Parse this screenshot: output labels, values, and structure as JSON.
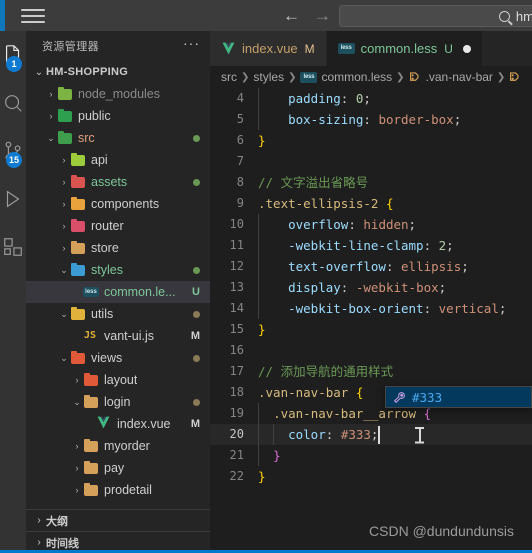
{
  "titlebar": {
    "menu_icon": "hamburger-menu-icon",
    "back_arrow": "←",
    "forward_arrow": "→",
    "search_value": "hm-sh",
    "search_icon": "search-icon"
  },
  "activitybar": {
    "items": [
      {
        "name": "explorer",
        "icon": "files-icon",
        "badge": "1"
      },
      {
        "name": "search",
        "icon": "search-icon",
        "badge": ""
      },
      {
        "name": "source-control",
        "icon": "source-control-icon",
        "badge": "15"
      },
      {
        "name": "run-and-debug",
        "icon": "run-debug-icon",
        "badge": ""
      },
      {
        "name": "extensions",
        "icon": "extensions-icon",
        "badge": ""
      }
    ]
  },
  "sidebar": {
    "title": "资源管理器",
    "more_actions": "···",
    "root": {
      "label": "HM-SHOPPING",
      "chevron": "⌄"
    },
    "tree": [
      {
        "indent": 1,
        "chevron": "›",
        "icon": "folder-node-modules",
        "color": "#7cb342",
        "label": "node_modules",
        "text_color": "#8a8a8a",
        "status": "",
        "dot": ""
      },
      {
        "indent": 1,
        "chevron": "›",
        "icon": "folder-public",
        "color": "#2e9e4f",
        "label": "public",
        "text_color": "#cfcfcf",
        "status": "",
        "dot": ""
      },
      {
        "indent": 1,
        "chevron": "⌄",
        "icon": "folder-src",
        "color": "#3f9e4d",
        "label": "src",
        "text_color": "#e0a080",
        "status": "",
        "dot": "#6a9955"
      },
      {
        "indent": 2,
        "chevron": "›",
        "icon": "folder-api",
        "color": "#9ccc3c",
        "label": "api",
        "text_color": "#cfcfcf",
        "status": "",
        "dot": ""
      },
      {
        "indent": 2,
        "chevron": "›",
        "icon": "folder-assets",
        "color": "#d9544f",
        "label": "assets",
        "text_color": "#7ec699",
        "status": "",
        "dot": "#6a9955"
      },
      {
        "indent": 2,
        "chevron": "›",
        "icon": "folder-components",
        "color": "#e8a33d",
        "label": "components",
        "text_color": "#cfcfcf",
        "status": "",
        "dot": ""
      },
      {
        "indent": 2,
        "chevron": "›",
        "icon": "folder-router",
        "color": "#d94f6a",
        "label": "router",
        "text_color": "#cfcfcf",
        "status": "",
        "dot": ""
      },
      {
        "indent": 2,
        "chevron": "›",
        "icon": "folder-store",
        "color": "#d5a05a",
        "label": "store",
        "text_color": "#cfcfcf",
        "status": "",
        "dot": ""
      },
      {
        "indent": 2,
        "chevron": "⌄",
        "icon": "folder-styles",
        "color": "#3d9bd4",
        "label": "styles",
        "text_color": "#7ec699",
        "status": "",
        "dot": "#6a9955"
      },
      {
        "indent": 3,
        "chevron": "",
        "icon": "file-less",
        "color": "#1e4f5f",
        "label": "common.le...",
        "text_color": "#7ec699",
        "status": "U",
        "status_color": "#7ec699",
        "dot": "",
        "selected": true
      },
      {
        "indent": 2,
        "chevron": "⌄",
        "icon": "folder-utils",
        "color": "#e0b23c",
        "label": "utils",
        "text_color": "#cfcfcf",
        "status": "",
        "dot": "#8a7a55"
      },
      {
        "indent": 3,
        "chevron": "",
        "icon": "file-js",
        "color": "#e0b23c",
        "label": "vant-ui.js",
        "text_color": "#cfcfcf",
        "status": "M",
        "status_color": "#cfcfcf",
        "dot": ""
      },
      {
        "indent": 2,
        "chevron": "⌄",
        "icon": "folder-views",
        "color": "#e05a3a",
        "label": "views",
        "text_color": "#cfcfcf",
        "status": "",
        "dot": "#8a7a55"
      },
      {
        "indent": 3,
        "chevron": "›",
        "icon": "folder-layout",
        "color": "#e05a3a",
        "label": "layout",
        "text_color": "#cfcfcf",
        "status": "",
        "dot": ""
      },
      {
        "indent": 3,
        "chevron": "⌄",
        "icon": "folder-login",
        "color": "#d5a05a",
        "label": "login",
        "text_color": "#cfcfcf",
        "status": "",
        "dot": "#8a7a55"
      },
      {
        "indent": 4,
        "chevron": "",
        "icon": "file-vue",
        "color": "#41b883",
        "label": "index.vue",
        "text_color": "#cfcfcf",
        "status": "M",
        "status_color": "#cfcfcf",
        "dot": ""
      },
      {
        "indent": 3,
        "chevron": "›",
        "icon": "folder-myorder",
        "color": "#d5a05a",
        "label": "myorder",
        "text_color": "#cfcfcf",
        "status": "",
        "dot": ""
      },
      {
        "indent": 3,
        "chevron": "›",
        "icon": "folder-pay",
        "color": "#d5a05a",
        "label": "pay",
        "text_color": "#cfcfcf",
        "status": "",
        "dot": ""
      },
      {
        "indent": 3,
        "chevron": "›",
        "icon": "folder-prodetail",
        "color": "#d5a05a",
        "label": "prodetail",
        "text_color": "#cfcfcf",
        "status": "",
        "dot": ""
      }
    ],
    "panels": [
      {
        "label": "大纲",
        "chevron": "›"
      },
      {
        "label": "时间线",
        "chevron": "›"
      }
    ]
  },
  "editor": {
    "tabs": [
      {
        "icon": "vue-file-icon",
        "label": "index.vue",
        "suffix": "M",
        "suffix_color": "#e2c08d",
        "label_color": "#c4a06a",
        "active": false,
        "dirty": false
      },
      {
        "icon": "less-file-icon",
        "label": "common.less",
        "suffix": "U",
        "suffix_color": "#7ec699",
        "label_color": "#7ec699",
        "active": true,
        "dirty": true
      }
    ],
    "breadcrumb": [
      {
        "label": "src",
        "icon": ""
      },
      {
        "label": "styles",
        "icon": ""
      },
      {
        "label": "common.less",
        "icon": "less-file-icon"
      },
      {
        "label": ".van-nav-bar",
        "icon": "css-selector-icon"
      },
      {
        "label": "",
        "icon": "css-selector-icon"
      }
    ],
    "lines": [
      {
        "num": "4",
        "tokens": [
          {
            "t": "    ",
            "c": "t-punc"
          },
          {
            "t": "padding",
            "c": "t-prop"
          },
          {
            "t": ": ",
            "c": "t-punc"
          },
          {
            "t": "0",
            "c": "t-num"
          },
          {
            "t": ";",
            "c": "t-punc"
          }
        ],
        "guides": [
          1
        ],
        "current": false
      },
      {
        "num": "5",
        "tokens": [
          {
            "t": "    ",
            "c": "t-punc"
          },
          {
            "t": "box-sizing",
            "c": "t-prop"
          },
          {
            "t": ": ",
            "c": "t-punc"
          },
          {
            "t": "border-box",
            "c": "t-val"
          },
          {
            "t": ";",
            "c": "t-punc"
          }
        ],
        "guides": [
          1
        ],
        "current": false
      },
      {
        "num": "6",
        "tokens": [
          {
            "t": "}",
            "c": "t-brace"
          }
        ],
        "guides": [],
        "current": false
      },
      {
        "num": "7",
        "tokens": [],
        "guides": [],
        "current": false
      },
      {
        "num": "8",
        "tokens": [
          {
            "t": "// 文字溢出省略号",
            "c": "t-cmt"
          }
        ],
        "guides": [],
        "current": false
      },
      {
        "num": "9",
        "tokens": [
          {
            "t": ".text-ellipsis-2",
            "c": "t-sel"
          },
          {
            "t": " ",
            "c": "t-punc"
          },
          {
            "t": "{",
            "c": "t-brace"
          }
        ],
        "guides": [],
        "current": false
      },
      {
        "num": "10",
        "tokens": [
          {
            "t": "    ",
            "c": "t-punc"
          },
          {
            "t": "overflow",
            "c": "t-prop"
          },
          {
            "t": ": ",
            "c": "t-punc"
          },
          {
            "t": "hidden",
            "c": "t-val"
          },
          {
            "t": ";",
            "c": "t-punc"
          }
        ],
        "guides": [
          1
        ],
        "current": false
      },
      {
        "num": "11",
        "tokens": [
          {
            "t": "    ",
            "c": "t-punc"
          },
          {
            "t": "-webkit-line-clamp",
            "c": "t-prop"
          },
          {
            "t": ": ",
            "c": "t-punc"
          },
          {
            "t": "2",
            "c": "t-num"
          },
          {
            "t": ";",
            "c": "t-punc"
          }
        ],
        "guides": [
          1
        ],
        "current": false
      },
      {
        "num": "12",
        "tokens": [
          {
            "t": "    ",
            "c": "t-punc"
          },
          {
            "t": "text-overflow",
            "c": "t-prop"
          },
          {
            "t": ": ",
            "c": "t-punc"
          },
          {
            "t": "ellipsis",
            "c": "t-val"
          },
          {
            "t": ";",
            "c": "t-punc"
          }
        ],
        "guides": [
          1
        ],
        "current": false
      },
      {
        "num": "13",
        "tokens": [
          {
            "t": "    ",
            "c": "t-punc"
          },
          {
            "t": "display",
            "c": "t-prop"
          },
          {
            "t": ": ",
            "c": "t-punc"
          },
          {
            "t": "-webkit-box",
            "c": "t-val"
          },
          {
            "t": ";",
            "c": "t-punc"
          }
        ],
        "guides": [
          1
        ],
        "current": false
      },
      {
        "num": "14",
        "tokens": [
          {
            "t": "    ",
            "c": "t-punc"
          },
          {
            "t": "-webkit-box-orient",
            "c": "t-prop"
          },
          {
            "t": ": ",
            "c": "t-punc"
          },
          {
            "t": "vertical",
            "c": "t-val"
          },
          {
            "t": ";",
            "c": "t-punc"
          }
        ],
        "guides": [
          1
        ],
        "current": false
      },
      {
        "num": "15",
        "tokens": [
          {
            "t": "}",
            "c": "t-brace"
          }
        ],
        "guides": [],
        "current": false
      },
      {
        "num": "16",
        "tokens": [],
        "guides": [],
        "current": false
      },
      {
        "num": "17",
        "tokens": [
          {
            "t": "// 添加导航的通用样式",
            "c": "t-cmt"
          }
        ],
        "guides": [],
        "current": false
      },
      {
        "num": "18",
        "tokens": [
          {
            "t": ".van-nav-bar",
            "c": "t-sel"
          },
          {
            "t": " ",
            "c": "t-punc"
          },
          {
            "t": "{",
            "c": "t-brace"
          }
        ],
        "guides": [],
        "current": false
      },
      {
        "num": "19",
        "tokens": [
          {
            "t": "  ",
            "c": "t-punc"
          },
          {
            "t": ".van-nav-bar__arrow",
            "c": "t-sel"
          },
          {
            "t": " ",
            "c": "t-punc"
          },
          {
            "t": "{",
            "c": "t-brace2"
          }
        ],
        "guides": [
          1
        ],
        "current": false
      },
      {
        "num": "20",
        "tokens": [
          {
            "t": "    ",
            "c": "t-punc"
          },
          {
            "t": "color",
            "c": "t-prop"
          },
          {
            "t": ": ",
            "c": "t-punc"
          },
          {
            "t": "#333",
            "c": "t-val"
          },
          {
            "t": ";",
            "c": "t-punc"
          }
        ],
        "guides": [
          1,
          2
        ],
        "current": true
      },
      {
        "num": "21",
        "tokens": [
          {
            "t": "  ",
            "c": "t-punc"
          },
          {
            "t": "}",
            "c": "t-brace2"
          }
        ],
        "guides": [
          1
        ],
        "current": false
      },
      {
        "num": "22",
        "tokens": [
          {
            "t": "}",
            "c": "t-brace"
          }
        ],
        "guides": [],
        "current": false
      }
    ],
    "suggest": {
      "icon": "color-tool-icon",
      "label": "#333"
    }
  },
  "watermark": "CSDN @dundundunsis"
}
